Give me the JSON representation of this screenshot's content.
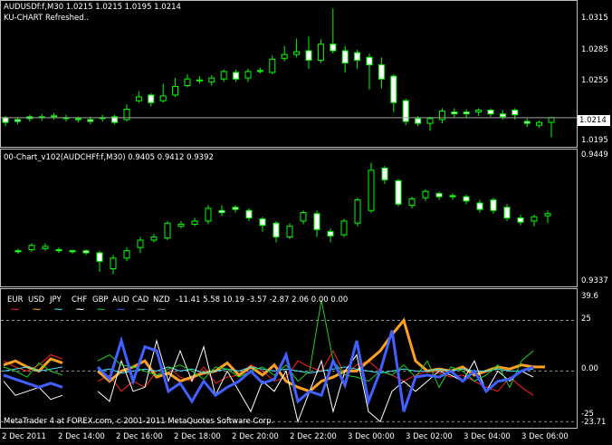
{
  "pane1": {
    "title": "AUDUSDf:f,M30  1.0215 1.0215 1.0195 1.0214",
    "subtitle": "KU-CHART Refreshed..",
    "scale_labels": [
      "1.0315",
      "1.0285",
      "1.0255",
      "1.0225",
      "1.0195"
    ],
    "current_price": "1.0214"
  },
  "pane2": {
    "title": "00-Chart_v102(AUDCHFf:f,M30) 0.9405 0.9412 0.9392",
    "scale_labels": [
      "0.9449",
      "0.9337"
    ]
  },
  "pane3": {
    "legend": {
      "currencies": [
        "EUR",
        "USD",
        "JPY",
        "CHF",
        "GBP",
        "AUD",
        "CAD",
        "NZD"
      ],
      "values": "-11.41 5.58 10.19 -3.57 -2.87 2.06 0.00 0.00"
    },
    "scale_labels": [
      "39.6",
      "25",
      "0.00",
      "-25",
      "-23.71"
    ],
    "footer": "MetaTrader 4 at FOREX.com, c 2001-2011 MetaQuotes Software Corp."
  },
  "time_axis": [
    "2 Dec 2011",
    "2 Dec 14:00",
    "2 Dec 16:00",
    "2 Dec 18:00",
    "2 Dec 20:00",
    "2 Dec 22:00",
    "3 Dec 00:00",
    "3 Dec 02:00",
    "3 Dec 04:00",
    "3 Dec 06:00"
  ],
  "colors": {
    "EUR": "#ff2020",
    "USD": "#ffa020",
    "JPY": "#40e0ff",
    "CHF": "#ffffff",
    "GBP": "#20d020",
    "AUD": "#4060ff",
    "CAD": "#808080",
    "NZD": "#808080",
    "candle": "#00ff00",
    "frame": "#c0c0c0"
  },
  "chart_data": [
    {
      "type": "candlestick",
      "title": "AUDUSDf:f,M30",
      "ylim": [
        1.0185,
        1.0335
      ],
      "open": [
        1.0214,
        1.0212,
        1.0215,
        1.0214,
        1.0216,
        1.0214,
        1.0213,
        1.0212,
        1.0214,
        1.0215,
        1.0212,
        1.0232,
        1.0238,
        1.0232,
        1.0238,
        1.0248,
        1.0254,
        1.0252,
        1.0255,
        1.0262,
        1.0256,
        1.0264,
        1.0262,
        1.0277,
        1.0281,
        1.0285,
        1.0275,
        1.0292,
        1.0285,
        1.0283,
        1.0278,
        1.027,
        1.0258,
        1.0232,
        1.0213,
        1.0208,
        1.0212,
        1.022,
        1.022,
        1.022,
        1.0222,
        1.0218,
        1.0222,
        1.021,
        1.0206,
        1.0209
      ],
      "close": [
        1.0209,
        1.021,
        1.0213,
        1.0215,
        1.0215,
        1.0213,
        1.0212,
        1.021,
        1.0213,
        1.0209,
        1.0223,
        1.0236,
        1.023,
        1.0237,
        1.0247,
        1.0255,
        1.0253,
        1.0256,
        1.0263,
        1.0255,
        1.0263,
        1.0264,
        1.0276,
        1.0281,
        1.0284,
        1.0275,
        1.0292,
        1.0285,
        1.0272,
        1.0275,
        1.027,
        1.0255,
        1.023,
        1.021,
        1.0208,
        1.0213,
        1.0221,
        1.0218,
        1.0218,
        1.0222,
        1.0218,
        1.0215,
        1.0217,
        1.0208,
        1.0209,
        1.0214
      ],
      "high": [
        1.0216,
        1.0214,
        1.0217,
        1.0218,
        1.0219,
        1.0217,
        1.0215,
        1.0215,
        1.0217,
        1.0217,
        1.0228,
        1.0242,
        1.024,
        1.025,
        1.0256,
        1.026,
        1.0258,
        1.0259,
        1.0265,
        1.0265,
        1.0266,
        1.0267,
        1.028,
        1.029,
        1.0298,
        1.03,
        1.0297,
        1.033,
        1.029,
        1.0286,
        1.0282,
        1.0278,
        1.026,
        1.0234,
        1.0216,
        1.0215,
        1.0224,
        1.0224,
        1.0223,
        1.0224,
        1.0224,
        1.0222,
        1.0224,
        1.0213,
        1.0211,
        1.0215
      ],
      "low": [
        1.0205,
        1.0207,
        1.021,
        1.0211,
        1.0212,
        1.021,
        1.0209,
        1.0207,
        1.021,
        1.0207,
        1.021,
        1.023,
        1.0226,
        1.023,
        1.0236,
        1.0246,
        1.025,
        1.0248,
        1.0252,
        1.0252,
        1.0252,
        1.0261,
        1.026,
        1.0274,
        1.0278,
        1.0266,
        1.0272,
        1.0282,
        1.0262,
        1.0266,
        1.0244,
        1.0245,
        1.022,
        1.0206,
        1.0205,
        1.02,
        1.0208,
        1.0214,
        1.0214,
        1.0216,
        1.0215,
        1.0212,
        1.0212,
        1.0204,
        1.0203,
        1.0193
      ]
    },
    {
      "type": "candlestick",
      "title": "00-Chart_v102(AUDCHFf:f,M30)",
      "ylim": [
        0.933,
        0.9455
      ],
      "open": [
        0.9362,
        0.9363,
        0.9364,
        0.9363,
        0.9362,
        0.9362,
        0.936,
        0.9345,
        0.9355,
        0.9365,
        0.9372,
        0.9374,
        0.9385,
        0.9387,
        0.939,
        0.94,
        0.9403,
        0.94,
        0.9392,
        0.9388,
        0.9375,
        0.939,
        0.9397,
        0.938,
        0.9377,
        0.9388,
        0.94,
        0.944,
        0.9428,
        0.9405,
        0.9412,
        0.9416,
        0.9414,
        0.9413,
        0.9407,
        0.941,
        0.9403,
        0.9393,
        0.939,
        0.9395
      ],
      "close": [
        0.9361,
        0.9367,
        0.9366,
        0.9362,
        0.9361,
        0.936,
        0.9352,
        0.9355,
        0.9362,
        0.9372,
        0.9375,
        0.9388,
        0.9387,
        0.939,
        0.9402,
        0.9398,
        0.9401,
        0.9393,
        0.9386,
        0.9375,
        0.9385,
        0.9398,
        0.9382,
        0.9376,
        0.939,
        0.941,
        0.9438,
        0.9429,
        0.9406,
        0.9411,
        0.9418,
        0.9413,
        0.9413,
        0.9409,
        0.9401,
        0.94,
        0.9393,
        0.9389,
        0.9394,
        0.9397
      ],
      "high": [
        0.9364,
        0.9369,
        0.9369,
        0.9365,
        0.9363,
        0.9363,
        0.9362,
        0.9358,
        0.9365,
        0.9375,
        0.9378,
        0.939,
        0.939,
        0.9393,
        0.9405,
        0.9405,
        0.9405,
        0.9402,
        0.9394,
        0.939,
        0.9388,
        0.94,
        0.94,
        0.9383,
        0.9392,
        0.9412,
        0.9445,
        0.9442,
        0.943,
        0.9413,
        0.942,
        0.9418,
        0.9416,
        0.9415,
        0.941,
        0.9412,
        0.9406,
        0.9396,
        0.9396,
        0.94
      ],
      "low": [
        0.9359,
        0.9361,
        0.9362,
        0.936,
        0.9359,
        0.9358,
        0.9342,
        0.934,
        0.9352,
        0.936,
        0.937,
        0.9372,
        0.9383,
        0.9385,
        0.9387,
        0.9395,
        0.9398,
        0.939,
        0.938,
        0.937,
        0.9373,
        0.9387,
        0.9375,
        0.937,
        0.9375,
        0.9385,
        0.9398,
        0.9425,
        0.9404,
        0.9402,
        0.9409,
        0.941,
        0.941,
        0.9406,
        0.9398,
        0.9397,
        0.939,
        0.9386,
        0.9385,
        0.9388
      ]
    },
    {
      "type": "line",
      "title": "Currency strength",
      "ylim": [
        -28,
        40
      ],
      "levels": [
        25,
        0,
        -25
      ],
      "series": [
        {
          "name": "EUR",
          "values": [
            5,
            2,
            0,
            3,
            8,
            6,
            null,
            null,
            -5,
            -2,
            -10,
            -5,
            -8,
            0,
            2,
            -3,
            -5,
            2,
            -6,
            -3,
            -2,
            3,
            0,
            -5,
            -3,
            5,
            2,
            0,
            10,
            -2,
            3,
            5,
            0,
            -2,
            -5,
            -2,
            0,
            -1,
            -3,
            -2,
            -5,
            -8,
            -10,
            -3,
            -8,
            -12
          ]
        },
        {
          "name": "USD",
          "values": [
            3,
            5,
            2,
            0,
            6,
            4,
            null,
            null,
            0,
            -5,
            0,
            2,
            5,
            -3,
            -1,
            -5,
            -3,
            -1,
            0,
            4,
            -2,
            2,
            -2,
            3,
            -5,
            -8,
            -10,
            -5,
            -3,
            0,
            0,
            5,
            10,
            18,
            25,
            5,
            0,
            1,
            0,
            2,
            -2,
            0,
            2,
            1,
            3,
            2,
            2
          ]
        },
        {
          "name": "JPY",
          "values": [
            0,
            1,
            2,
            0,
            1,
            2,
            null,
            null,
            0,
            1,
            -1,
            0,
            1,
            0,
            2,
            0,
            1,
            -1,
            0,
            1,
            0,
            2,
            1,
            0,
            1,
            0,
            -1,
            0,
            1,
            2,
            1,
            0,
            -1,
            0,
            1,
            0,
            0,
            1,
            0,
            1,
            0,
            0,
            1,
            0,
            0,
            1
          ]
        },
        {
          "name": "CHF",
          "values": [
            -5,
            -12,
            -10,
            -8,
            -14,
            -12,
            null,
            null,
            -10,
            -15,
            5,
            -10,
            -8,
            15,
            -5,
            10,
            -5,
            12,
            -12,
            0,
            -10,
            -20,
            -5,
            -10,
            0,
            -25,
            -10,
            5,
            -20,
            0,
            8,
            -20,
            -25,
            -10,
            -5,
            -10,
            -5,
            0,
            -2,
            -5,
            5,
            -10,
            0,
            -5,
            0,
            -3
          ]
        },
        {
          "name": "GBP",
          "values": [
            2,
            0,
            -3,
            4,
            0,
            -2,
            null,
            null,
            5,
            8,
            3,
            2,
            0,
            -2,
            1,
            3,
            0,
            -4,
            2,
            1,
            -3,
            0,
            2,
            -2,
            3,
            -5,
            0,
            35,
            5,
            -2,
            -3,
            -5,
            0,
            -2,
            3,
            -3,
            5,
            -8,
            2,
            0,
            -5,
            -2,
            3,
            -8,
            5,
            10
          ]
        },
        {
          "name": "AUD",
          "values": [
            -2,
            -4,
            -6,
            -8,
            -6,
            -8,
            null,
            null,
            2,
            -4,
            15,
            -5,
            12,
            10,
            -10,
            -6,
            -15,
            -5,
            -12,
            -8,
            -5,
            0,
            -6,
            -4,
            8,
            -15,
            -10,
            -12,
            5,
            -7,
            15,
            -15,
            0,
            20,
            -20,
            -3,
            -2,
            -3,
            0,
            -5,
            0,
            -10,
            -5,
            -4,
            0,
            2
          ]
        }
      ]
    }
  ]
}
